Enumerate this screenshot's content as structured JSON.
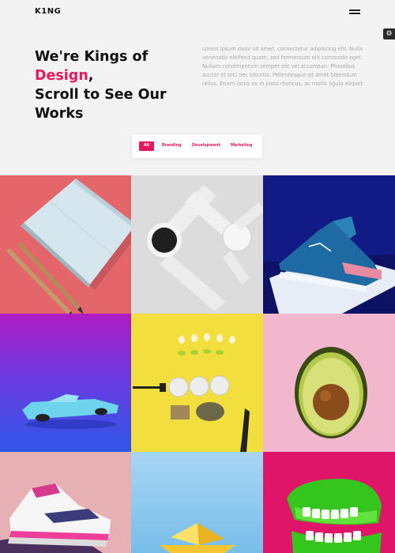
{
  "header": {
    "logo": "K1NG",
    "menu_icon": "hamburger-icon",
    "settings_icon": "gear-icon"
  },
  "hero": {
    "headline_before": "We're Kings of ",
    "headline_accent": "Design",
    "headline_comma": ",",
    "headline_line2": "Scroll to See Our",
    "headline_line3": "Works",
    "paragraph": "Lorem ipsum dolor sit amet, consectetur adipiscing elit. Nulla venenatis eleifend quam, sed fermentum elit commodo eget. Nullam condimentum semper elit vel accumsan. Phasellus auctor et orci nec lobortis. Pellentesque sit amet bibendum tellus. Etiam lacus ex in justo rhoncus, ac mollis ligula aliquet."
  },
  "filters": [
    {
      "label": "All",
      "active": true
    },
    {
      "label": "Branding",
      "active": false
    },
    {
      "label": "Development",
      "active": false
    },
    {
      "label": "Marketing",
      "active": false
    }
  ],
  "colors": {
    "accent": "#e6175c",
    "background": "#f3f3f3"
  },
  "portfolio": [
    {
      "subject": "notebook-and-pencils",
      "background": "#e4656a"
    },
    {
      "subject": "smartwatch",
      "background": "#dedede"
    },
    {
      "subject": "sneaker-on-pedestal",
      "background": "#141c8c"
    },
    {
      "subject": "toy-car",
      "background": "#4a6fe8"
    },
    {
      "subject": "food-arrangement",
      "background": "#f2de3c"
    },
    {
      "subject": "avocado",
      "background": "#f2b7cc"
    },
    {
      "subject": "nike-sneaker",
      "background": "#e7b0b4"
    },
    {
      "subject": "paper-boat",
      "background": "#8fc9ee"
    },
    {
      "subject": "chattering-teeth",
      "background": "#e0156a"
    }
  ]
}
